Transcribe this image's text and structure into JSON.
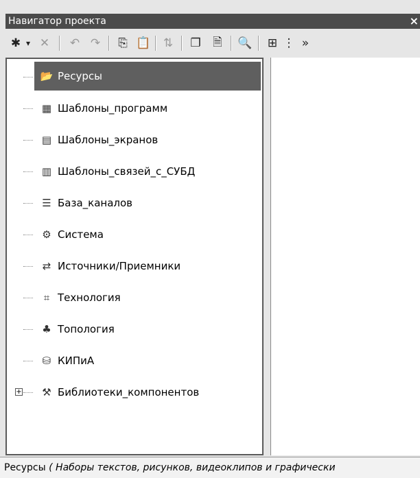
{
  "window": {
    "title": "Навигатор проекта",
    "close_glyph": "×"
  },
  "toolbar": {
    "buttons": [
      {
        "icon": "new-item-icon",
        "glyph": "✱",
        "enabled": true
      },
      {
        "icon": "dropdown-arrow-icon",
        "glyph": "▾",
        "enabled": true
      },
      {
        "icon": "delete-icon",
        "glyph": "✕",
        "enabled": false
      },
      {
        "icon": "undo-icon",
        "glyph": "↶",
        "enabled": false
      },
      {
        "icon": "redo-icon",
        "glyph": "↷",
        "enabled": false
      },
      {
        "icon": "copy-icon",
        "glyph": "⎘",
        "enabled": true
      },
      {
        "icon": "paste-icon",
        "glyph": "📋",
        "enabled": false
      },
      {
        "icon": "move-icon",
        "glyph": "⇅",
        "enabled": false
      },
      {
        "icon": "duplicate-icon",
        "glyph": "❐",
        "enabled": true
      },
      {
        "icon": "properties-icon",
        "glyph": "🗎",
        "enabled": true
      },
      {
        "icon": "find-icon",
        "glyph": "🔍",
        "enabled": true
      },
      {
        "icon": "tree-expand-icon",
        "glyph": "⊞",
        "enabled": true
      },
      {
        "icon": "tree-collapse-icon",
        "glyph": "⋮",
        "enabled": true
      },
      {
        "icon": "overflow-icon",
        "glyph": "»",
        "enabled": true
      }
    ]
  },
  "tree": {
    "items": [
      {
        "label": "Ресурсы",
        "icon": "folder-open-icon",
        "glyph": "📂",
        "selected": true
      },
      {
        "label": "Шаблоны_программ",
        "icon": "program-templates-icon",
        "glyph": "▦",
        "selected": false
      },
      {
        "label": "Шаблоны_экранов",
        "icon": "screen-templates-icon",
        "glyph": "▤",
        "selected": false
      },
      {
        "label": "Шаблоны_связей_с_СУБД",
        "icon": "db-links-icon",
        "glyph": "▥",
        "selected": false
      },
      {
        "label": "База_каналов",
        "icon": "channel-base-icon",
        "glyph": "☰",
        "selected": false
      },
      {
        "label": "Система",
        "icon": "system-icon",
        "glyph": "⚙",
        "selected": false
      },
      {
        "label": "Источники/Приемники",
        "icon": "sources-receivers-icon",
        "glyph": "⇄",
        "selected": false
      },
      {
        "label": "Технология",
        "icon": "technology-icon",
        "glyph": "⌗",
        "selected": false
      },
      {
        "label": "Топология",
        "icon": "topology-icon",
        "glyph": "♣",
        "selected": false
      },
      {
        "label": "КИПиА",
        "icon": "kipia-icon",
        "glyph": "⛁",
        "selected": false
      },
      {
        "label": "Библиотеки_компонентов",
        "icon": "component-libraries-icon",
        "glyph": "⚒",
        "selected": false,
        "expander": "+"
      }
    ]
  },
  "status": {
    "label": "Ресурсы",
    "description": " ( Наборы текстов, рисунков, видеоклипов и графически"
  }
}
